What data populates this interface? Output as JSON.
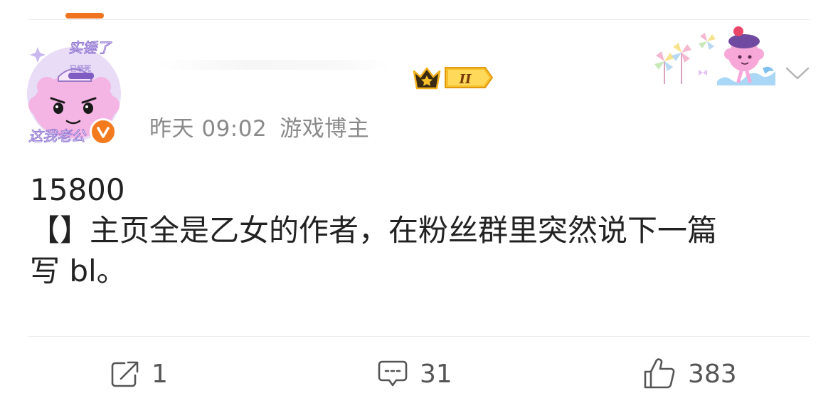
{
  "post": {
    "avatar_caption_top": "实锤了",
    "avatar_caption_mid": "已经死",
    "avatar_caption_bottom": "这我老公",
    "meta": {
      "time": "昨天 09:02",
      "tag": "游戏博主"
    },
    "badge": {
      "level": "II"
    },
    "content": {
      "line1": "15800",
      "line2": "【】主页全是乙女的作者，在粉丝群里突然说下一篇",
      "line3": "写 bl。"
    }
  },
  "actions": {
    "repost": {
      "icon": "share-icon",
      "count": "1"
    },
    "comment": {
      "icon": "comment-icon",
      "count": "31"
    },
    "like": {
      "icon": "thumbs-up-icon",
      "count": "383"
    }
  },
  "colors": {
    "accent": "#f0731f",
    "meta_text": "#8a8a8a",
    "body_text": "#222222",
    "avatar_pink": "#f4b4e4",
    "gold": "#f7c02b"
  }
}
